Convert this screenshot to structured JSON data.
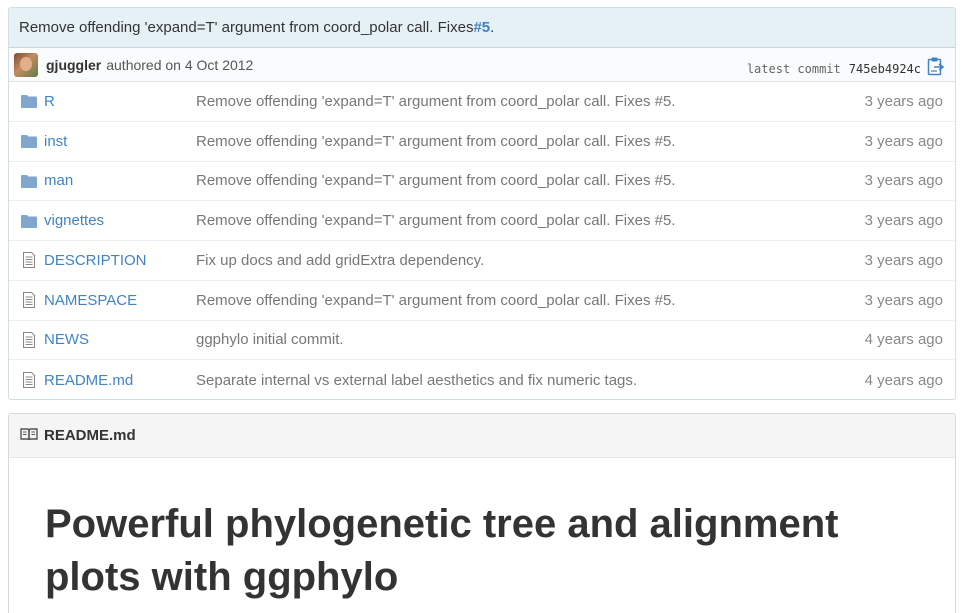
{
  "commit": {
    "message": "Remove offending 'expand=T' argument from coord_polar call. Fixes ",
    "issue": "#5",
    "issue_suffix": ".",
    "author": "gjuggler",
    "authored_text": "authored on 4 Oct 2012",
    "latest_label": "latest commit",
    "sha": "745eb4924c",
    "copy_icon": "clipboard-icon"
  },
  "files": [
    {
      "type": "folder",
      "name": "R",
      "message": "Remove offending 'expand=T' argument from coord_polar call. Fixes #5.",
      "age": "3 years ago"
    },
    {
      "type": "folder",
      "name": "inst",
      "message": "Remove offending 'expand=T' argument from coord_polar call. Fixes #5.",
      "age": "3 years ago"
    },
    {
      "type": "folder",
      "name": "man",
      "message": "Remove offending 'expand=T' argument from coord_polar call. Fixes #5.",
      "age": "3 years ago"
    },
    {
      "type": "folder",
      "name": "vignettes",
      "message": "Remove offending 'expand=T' argument from coord_polar call. Fixes #5.",
      "age": "3 years ago"
    },
    {
      "type": "file",
      "name": "DESCRIPTION",
      "message": "Fix up docs and add gridExtra dependency.",
      "age": "3 years ago"
    },
    {
      "type": "file",
      "name": "NAMESPACE",
      "message": "Remove offending 'expand=T' argument from coord_polar call. Fixes #5.",
      "age": "3 years ago"
    },
    {
      "type": "file",
      "name": "NEWS",
      "message": "ggphylo initial commit.",
      "age": "4 years ago"
    },
    {
      "type": "file",
      "name": "README.md",
      "message": "Separate internal vs external label aesthetics and fix numeric tags.",
      "age": "4 years ago"
    }
  ],
  "readme": {
    "header": "README.md",
    "icon": "book-icon",
    "title": "Powerful phylogenetic tree and alignment plots with ggphylo"
  },
  "colors": {
    "link": "#4183c4",
    "folder": "#80a6cd",
    "commit_bg": "#e6f1f6"
  }
}
